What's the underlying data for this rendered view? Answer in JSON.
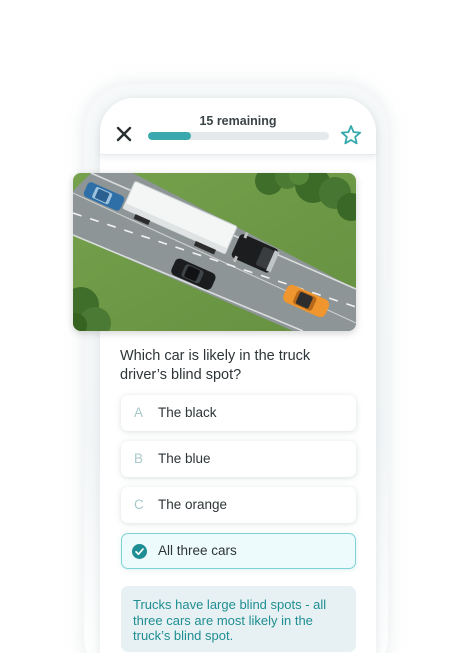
{
  "header": {
    "remaining_label": "15 remaining",
    "progress_fraction": 0.24,
    "close_icon": "close-icon",
    "favorite_icon": "star-outline-icon"
  },
  "scene": {
    "image_icon": "highway-truck-scene-illustration"
  },
  "question": {
    "text": "Which car is likely in the truck driver’s blind spot?"
  },
  "options": [
    {
      "letter": "A",
      "label": "The black"
    },
    {
      "letter": "B",
      "label": "The blue"
    },
    {
      "letter": "C",
      "label": "The orange"
    },
    {
      "letter": "",
      "label": "All three cars",
      "selected": true
    }
  ],
  "feedback": {
    "text": "Trucks have large blind spots - all three cars are most likely in the truck’s blind spot."
  },
  "colors": {
    "accent": "#3aa9ad",
    "feedback_text": "#1f8e92",
    "feedback_bg": "#e7f1f3",
    "selected_border": "#7fd2d6"
  }
}
